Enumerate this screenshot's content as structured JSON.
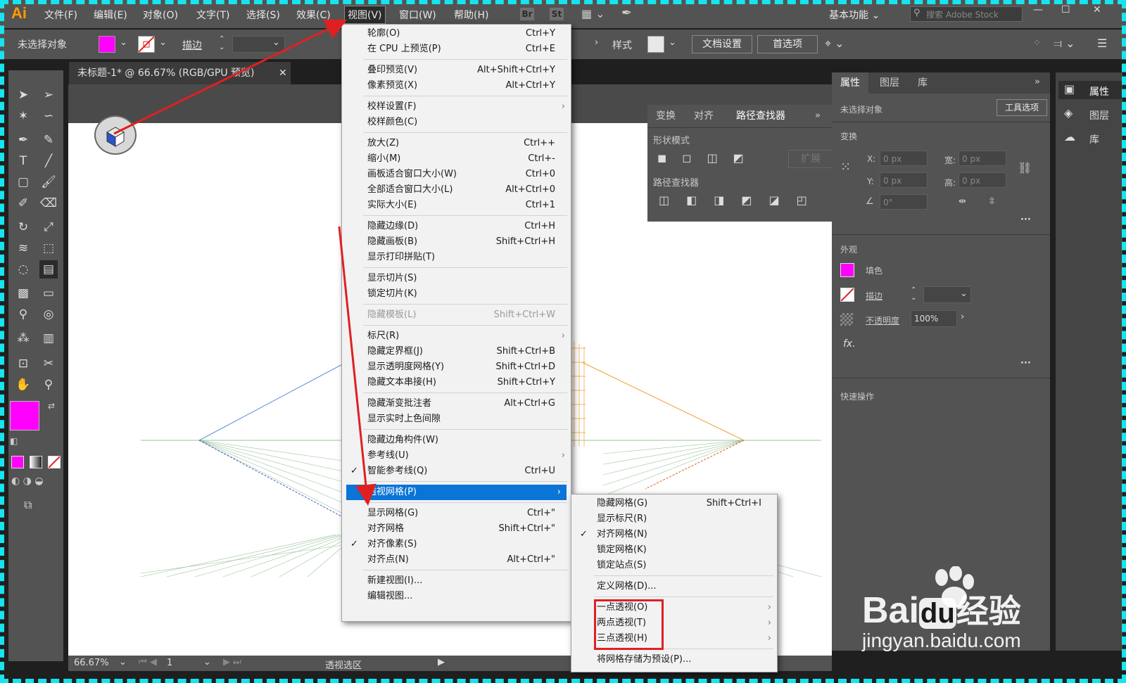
{
  "app": {
    "logo": "Ai",
    "accent": "#ff9a00"
  },
  "menubar": {
    "items": [
      "文件(F)",
      "编辑(E)",
      "对象(O)",
      "文字(T)",
      "选择(S)",
      "效果(C)",
      "视图(V)",
      "窗口(W)",
      "帮助(H)"
    ],
    "badges": [
      "Br",
      "St"
    ],
    "workspace": "基本功能",
    "stock_placeholder": "搜索 Adobe Stock"
  },
  "controlbar": {
    "no_selection": "未选择对象",
    "stroke_label": "描边",
    "style_label": "样式",
    "doc_setup": "文档设置",
    "preferences": "首选项",
    "fill_color": "#ff00ff"
  },
  "document": {
    "tab_title": "未标题-1* @ 66.67% (RGB/GPU 预览)"
  },
  "statusbar": {
    "zoom": "66.67%",
    "page": "1",
    "selection": "透视选区"
  },
  "pathfinder": {
    "tabs": [
      "变换",
      "对齐",
      "路径查找器"
    ],
    "shape_modes": "形状模式",
    "expand": "扩展",
    "pathfinders": "路径查找器"
  },
  "properties": {
    "tabs": [
      "属性",
      "图层",
      "库"
    ],
    "no_selection": "未选择对象",
    "tool_options": "工具选项",
    "transform": "变换",
    "x_label": "X:",
    "y_label": "Y:",
    "w_label": "宽:",
    "h_label": "高:",
    "x_val": "0 px",
    "y_val": "0 px",
    "w_val": "0 px",
    "h_val": "0 px",
    "angle": "0°",
    "appearance": "外观",
    "fill": "填色",
    "stroke": "描边",
    "opacity_label": "不透明度",
    "opacity": "100%",
    "fx": "fx.",
    "quick_actions": "快速操作"
  },
  "rightbar": {
    "items": [
      "属性",
      "图层",
      "库"
    ]
  },
  "view_menu": {
    "items": [
      {
        "label": "轮廓(O)",
        "shortcut": "Ctrl+Y"
      },
      {
        "label": "在 CPU 上预览(P)",
        "shortcut": "Ctrl+E"
      },
      {
        "label": "叠印预览(V)",
        "shortcut": "Alt+Shift+Ctrl+Y"
      },
      {
        "label": "像素预览(X)",
        "shortcut": "Alt+Ctrl+Y"
      },
      {
        "label": "校样设置(F)",
        "shortcut": ""
      },
      {
        "label": "校样颜色(C)",
        "shortcut": ""
      },
      {
        "label": "放大(Z)",
        "shortcut": "Ctrl++"
      },
      {
        "label": "缩小(M)",
        "shortcut": "Ctrl+-"
      },
      {
        "label": "画板适合窗口大小(W)",
        "shortcut": "Ctrl+0"
      },
      {
        "label": "全部适合窗口大小(L)",
        "shortcut": "Alt+Ctrl+0"
      },
      {
        "label": "实际大小(E)",
        "shortcut": "Ctrl+1"
      },
      {
        "label": "隐藏边缘(D)",
        "shortcut": "Ctrl+H"
      },
      {
        "label": "隐藏画板(B)",
        "shortcut": "Shift+Ctrl+H"
      },
      {
        "label": "显示打印拼贴(T)",
        "shortcut": ""
      },
      {
        "label": "显示切片(S)",
        "shortcut": ""
      },
      {
        "label": "锁定切片(K)",
        "shortcut": ""
      },
      {
        "label": "隐藏模板(L)",
        "shortcut": "Shift+Ctrl+W"
      },
      {
        "label": "标尺(R)",
        "shortcut": ""
      },
      {
        "label": "隐藏定界框(J)",
        "shortcut": "Shift+Ctrl+B"
      },
      {
        "label": "显示透明度网格(Y)",
        "shortcut": "Shift+Ctrl+D"
      },
      {
        "label": "隐藏文本串接(H)",
        "shortcut": "Shift+Ctrl+Y"
      },
      {
        "label": "隐藏渐变批注者",
        "shortcut": "Alt+Ctrl+G"
      },
      {
        "label": "显示实时上色间隙",
        "shortcut": ""
      },
      {
        "label": "隐藏边角构件(W)",
        "shortcut": ""
      },
      {
        "label": "参考线(U)",
        "shortcut": ""
      },
      {
        "label": "智能参考线(Q)",
        "shortcut": "Ctrl+U"
      },
      {
        "label": "透视网格(P)",
        "shortcut": ""
      },
      {
        "label": "显示网格(G)",
        "shortcut": "Ctrl+\""
      },
      {
        "label": "对齐网格",
        "shortcut": "Shift+Ctrl+\""
      },
      {
        "label": "对齐像素(S)",
        "shortcut": ""
      },
      {
        "label": "对齐点(N)",
        "shortcut": "Alt+Ctrl+\""
      },
      {
        "label": "新建视图(I)...",
        "shortcut": ""
      },
      {
        "label": "编辑视图...",
        "shortcut": ""
      }
    ]
  },
  "perspective_submenu": {
    "items": [
      {
        "label": "隐藏网格(G)",
        "shortcut": "Shift+Ctrl+I"
      },
      {
        "label": "显示标尺(R)",
        "shortcut": ""
      },
      {
        "label": "对齐网格(N)",
        "shortcut": ""
      },
      {
        "label": "锁定网格(K)",
        "shortcut": ""
      },
      {
        "label": "锁定站点(S)",
        "shortcut": ""
      },
      {
        "label": "定义网格(D)...",
        "shortcut": ""
      },
      {
        "label": "一点透视(O)",
        "shortcut": ""
      },
      {
        "label": "两点透视(T)",
        "shortcut": ""
      },
      {
        "label": "三点透视(H)",
        "shortcut": ""
      },
      {
        "label": "将网格存储为预设(P)...",
        "shortcut": ""
      }
    ]
  },
  "watermark": {
    "brand": "Bai",
    "du": "du",
    "jingyan": "经验",
    "url": "jingyan.baidu.com"
  },
  "colors": {
    "highlight": "#0a74d7",
    "annotation_red": "#e02020",
    "frame": "#16e4ee"
  }
}
